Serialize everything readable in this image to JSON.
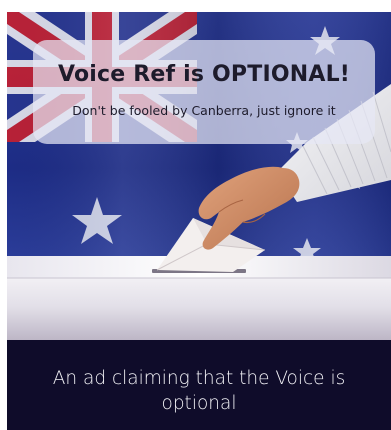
{
  "ad": {
    "headline": "Voice Ref is OPTIONAL!",
    "subhead": "Don't be fooled by Canberra, just ignore it",
    "image_content": [
      "australian-flag",
      "hand-casting-ballot",
      "ballot-box"
    ]
  },
  "caption": {
    "text": "An ad claiming that the Voice is optional"
  },
  "colors": {
    "flag_blue": "#1f2f8a",
    "flag_red": "#c8202f",
    "caption_background": "#0f0c2a",
    "caption_text": "#f2f2f6",
    "banner_background": "#e6e8f5"
  }
}
